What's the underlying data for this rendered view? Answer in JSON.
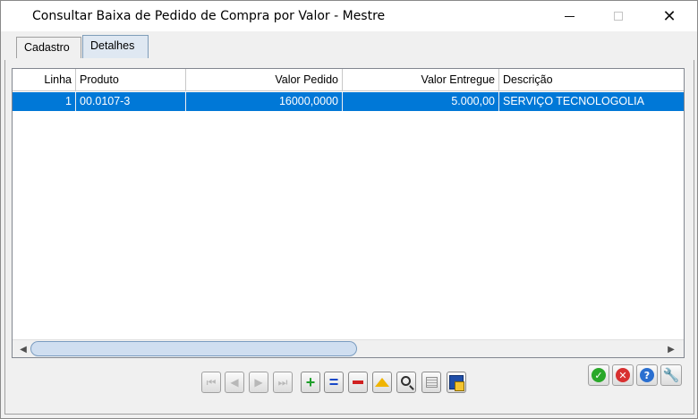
{
  "window": {
    "title": "Consultar Baixa de Pedido de Compra por Valor - Mestre",
    "minimize_icon": "minimize-icon",
    "maximize_icon": "maximize-icon",
    "close_glyph": "✕"
  },
  "tabs": [
    {
      "label": "Cadastro",
      "selected": false
    },
    {
      "label": "Detalhes",
      "selected": true
    }
  ],
  "grid": {
    "columns": [
      "Linha",
      "Produto",
      "Valor Pedido",
      "Valor Entregue",
      "Descrição"
    ],
    "rows": [
      [
        "1",
        "00.0107-3",
        "16000,0000",
        "5.000,00",
        "SERVIÇO TECNOLOGOLIA"
      ]
    ],
    "selected_row_color": "#0078d7"
  },
  "navigation": {
    "buttons": [
      "first-record-icon",
      "previous-record-icon",
      "next-record-icon",
      "last-record-icon",
      "insert-icon",
      "edit-icon",
      "delete-icon",
      "sort-icon",
      "search-icon",
      "table-view-icon",
      "export-icon"
    ]
  },
  "actions": {
    "buttons": [
      "confirm-icon",
      "cancel-icon",
      "help-icon",
      "settings-wrench-icon"
    ]
  }
}
